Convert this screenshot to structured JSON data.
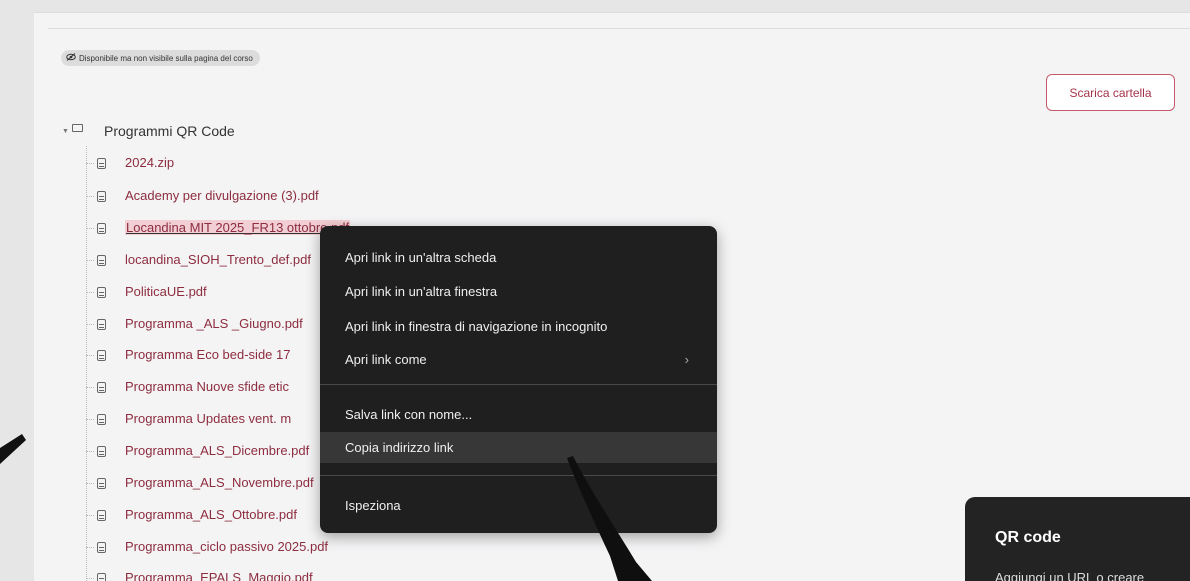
{
  "badge": {
    "icon": "eye-slash-icon",
    "text": "Disponibile ma non visibile sulla pagina del corso"
  },
  "download_button": "Scarica cartella",
  "folder": {
    "name": "Programmi QR Code"
  },
  "files": [
    "2024.zip",
    "Academy per divulgazione (3).pdf",
    "Locandina MIT 2025_FR13 ottobre.pdf",
    "locandina_SIOH_Trento_def.pdf",
    "PoliticaUE.pdf",
    "Programma _ALS _Giugno.pdf",
    "Programma Eco bed-side 17",
    "Programma Nuove sfide etic",
    "Programma Updates vent. m",
    "Programma_ALS_Dicembre.pdf",
    "Programma_ALS_Novembre.pdf",
    "Programma_ALS_Ottobre.pdf",
    "Programma_ciclo passivo 2025.pdf",
    "Programma_EPALS_Maggio.pdf"
  ],
  "context_menu": {
    "items": [
      "Apri link in un'altra scheda",
      "Apri link in un'altra finestra",
      "Apri link in finestra di navigazione in incognito",
      "Apri link come",
      "Salva link con nome...",
      "Copia indirizzo link",
      "Ispeziona"
    ],
    "submenu_glyph": "›"
  },
  "qr_panel": {
    "title": "QR code",
    "subtitle": "Aggiungi un URL o creare"
  },
  "colors": {
    "link": "#8d2d3f",
    "accent": "#c25a6a",
    "menu_bg": "#1f1f1f"
  }
}
